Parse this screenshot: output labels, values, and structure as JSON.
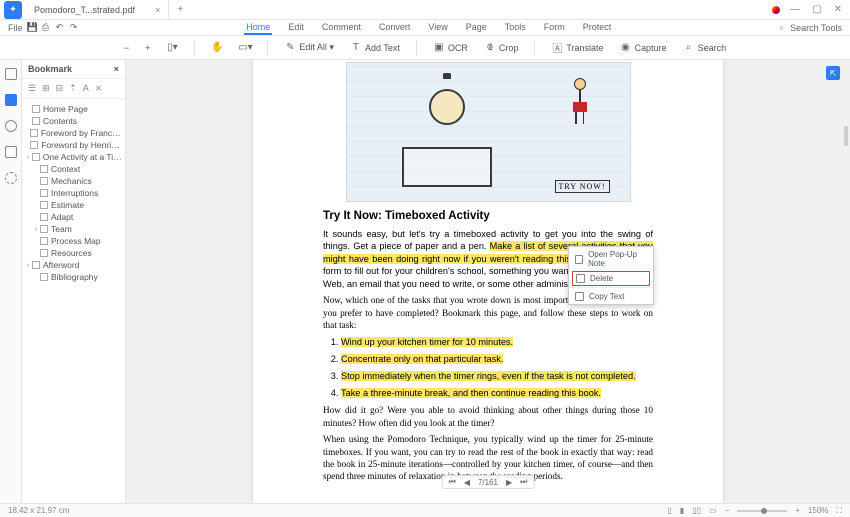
{
  "window": {
    "file_tab": "Pomodoro_T...strated.pdf",
    "controls": {
      "min": "—",
      "max": "▢",
      "close": "✕"
    }
  },
  "menu": {
    "file": "File",
    "tabs": [
      "Home",
      "Edit",
      "Comment",
      "Convert",
      "View",
      "Page",
      "Tools",
      "Form",
      "Protect"
    ],
    "active_tab": "Home",
    "search_tools": "Search Tools"
  },
  "toolbar": {
    "zoom_out": "−",
    "zoom_in": "+",
    "hand": "✋",
    "select": "▭",
    "edit_all": "Edit All ▾",
    "add_text": "Add Text",
    "ocr": "OCR",
    "crop": "Crop",
    "translate": "Translate",
    "capture": "Capture",
    "search": "Search"
  },
  "bookmark": {
    "title": "Bookmark",
    "items": [
      {
        "label": "Home Page",
        "indent": 0,
        "chevron": ""
      },
      {
        "label": "Contents",
        "indent": 0,
        "chevron": ""
      },
      {
        "label": "Foreword by Francesco Cirillo",
        "indent": 0,
        "chevron": ""
      },
      {
        "label": "Foreword by Henrik Kniberg",
        "indent": 0,
        "chevron": ""
      },
      {
        "label": "One Activity at a Time",
        "indent": 0,
        "chevron": "›"
      },
      {
        "label": "Context",
        "indent": 1,
        "chevron": ""
      },
      {
        "label": "Mechanics",
        "indent": 1,
        "chevron": ""
      },
      {
        "label": "Interruptions",
        "indent": 1,
        "chevron": ""
      },
      {
        "label": "Estimate",
        "indent": 1,
        "chevron": ""
      },
      {
        "label": "Adapt",
        "indent": 1,
        "chevron": ""
      },
      {
        "label": "Team",
        "indent": 1,
        "chevron": "›"
      },
      {
        "label": "Process Map",
        "indent": 1,
        "chevron": ""
      },
      {
        "label": "Resources",
        "indent": 1,
        "chevron": ""
      },
      {
        "label": "Afterword",
        "indent": 0,
        "chevron": "›"
      },
      {
        "label": "Bibliography",
        "indent": 1,
        "chevron": ""
      }
    ]
  },
  "page": {
    "illustration_label": "TRY NOW!",
    "section_title": "Try It Now: Timeboxed Activity",
    "para1_a": "It sounds easy, but let's try a timeboxed activity to get you into the swing of things. Get a piece of paper and a pen. ",
    "para1_hl": "Make a list of several activities that you might have been doing right now if you weren't reading this book.",
    "para1_b": " It could be a form to fill out for your children's school, something you wanted to look up on the Web, an email that you need to write, or some other administrative task.",
    "para2": "Now, which one of the tasks that you wrote down is most important? Which one would you prefer to have completed? Bookmark this page, and follow these steps to work on that task:",
    "list": [
      "Wind up your kitchen timer for 10 minutes.",
      "Concentrate only on that particular task.",
      "Stop immediately when the timer rings, even if the task is not completed.",
      "Take a three-minute break, and then continue reading this book."
    ],
    "para3": "How did it go? Were you able to avoid thinking about other things during those 10 minutes? How often did you look at the timer?",
    "para4": "When using the Pomodoro Technique, you typically wind up the timer for 25-minute timeboxes. If you want, you can try to read the rest of the book in exactly that way: read the book in 25-minute iterations—controlled by your kitchen timer, of course—and then spend three minutes of relaxation in between the reading periods."
  },
  "context_menu": {
    "item1": "Open Pop-Up Note",
    "item2": "Delete",
    "item3": "Copy Text"
  },
  "status": {
    "page_size": "18.42 x 21.97 cm",
    "page_indicator": "7/161",
    "zoom": "150%"
  },
  "goto_badge": "⇱"
}
